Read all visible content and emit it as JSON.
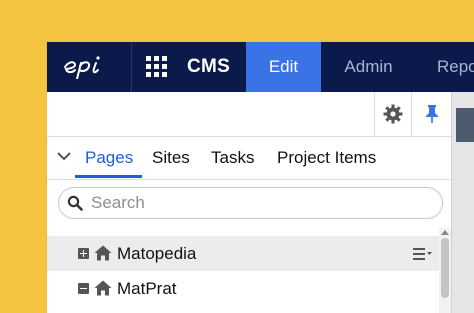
{
  "nav": {
    "logo_text": "epi",
    "product": "CMS",
    "tabs": [
      {
        "label": "Edit",
        "active": true
      },
      {
        "label": "Admin",
        "active": false
      },
      {
        "label": "Repo",
        "active": false
      }
    ]
  },
  "toolbar": {
    "settings_icon": "gear-icon",
    "pin_icon": "pin-icon"
  },
  "pane": {
    "subtabs": [
      {
        "label": "Pages",
        "active": true
      },
      {
        "label": "Sites",
        "active": false
      },
      {
        "label": "Tasks",
        "active": false
      },
      {
        "label": "Project Items",
        "active": false
      }
    ]
  },
  "search": {
    "placeholder": "Search",
    "value": ""
  },
  "tree": {
    "items": [
      {
        "label": "Matopedia",
        "expander": "plus",
        "selected": true
      },
      {
        "label": "MatPrat",
        "expander": "minus",
        "selected": false
      }
    ]
  },
  "colors": {
    "background": "#f5c542",
    "nav": "#0b1a4a",
    "accent": "#3a73e6",
    "active_tab_text": "#1e5fd8"
  }
}
